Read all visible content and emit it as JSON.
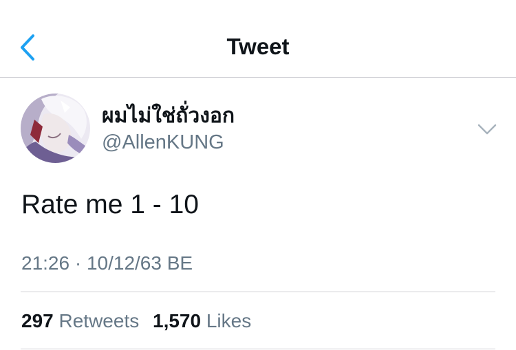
{
  "nav": {
    "title": "Tweet",
    "back_icon": "chevron-left-icon",
    "accent_color": "#1da1f2"
  },
  "author": {
    "display_name": "ผมไม่ใช่ถั่วงอก",
    "handle": "@AllenKUNG",
    "avatar_icon": "profile-avatar-image",
    "more_icon": "chevron-down-icon"
  },
  "tweet": {
    "text": "Rate me 1 - 10",
    "timestamp": "21:26 · 10/12/63 BE"
  },
  "stats": {
    "retweets_count": "297",
    "retweets_label": "Retweets",
    "likes_count": "1,570",
    "likes_label": "Likes"
  }
}
